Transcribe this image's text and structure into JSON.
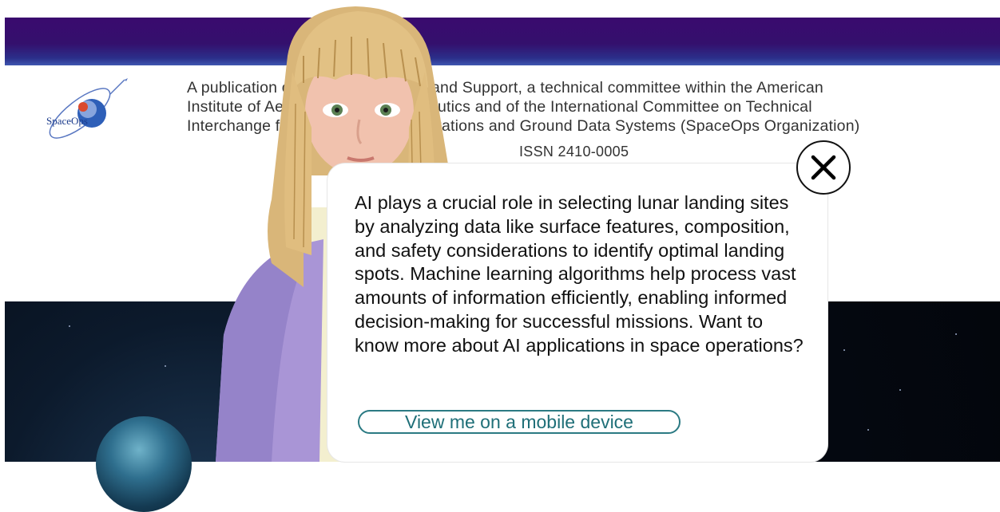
{
  "header": {
    "logo_text": "SpaceOps",
    "publication_lines": [
      "A publication of Space Operations and Support, a technical committee within the American",
      "Institute of Aeronautics and Astronautics and of the International Committee on Technical",
      "Interchange for Space Mission Operations and Ground Data Systems (SpaceOps Organization)"
    ],
    "issn": "ISSN 2410-0005"
  },
  "chat": {
    "message": "AI plays a crucial role in selecting lunar landing sites by analyzing data like surface features, composition, and safety considerations to identify optimal landing spots. Machine learning algorithms help process vast amounts of information efficiently, enabling informed decision-making for successful missions. Want to know more about AI applications in space operations?",
    "mobile_button_label": "View me on a mobile device",
    "close_icon": "close-icon"
  },
  "colors": {
    "banner": "#3a0a6e",
    "button_border": "#2b7a83",
    "button_text": "#1f6f78"
  }
}
